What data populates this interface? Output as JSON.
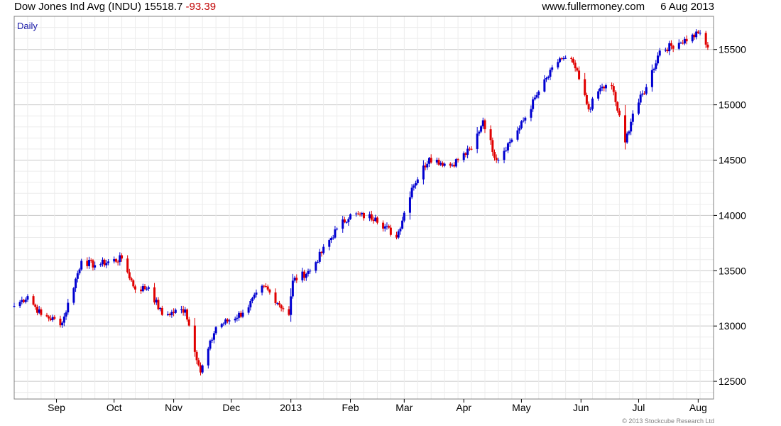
{
  "header": {
    "instrument": "Dow Jones Ind Avg (INDU)",
    "last": "15518.7",
    "change": "-93.39",
    "website": "www.fullermoney.com",
    "date": "6 Aug 2013"
  },
  "footer": {
    "copyright": "© 2013 Stockcube Research Ltd"
  },
  "colors": {
    "up": "#0000d0",
    "down": "#e00000",
    "grid_major": "#c8c8c8",
    "grid_minor": "#ececec",
    "frame": "#808080"
  },
  "chart_data": {
    "type": "line",
    "style": "daily high-low-close bars, blue up / red down",
    "period_label": "Daily",
    "y_axis_side": "right",
    "ylim": [
      12340,
      15800
    ],
    "y_ticks": [
      12500,
      13000,
      13500,
      14000,
      14500,
      15000,
      15500
    ],
    "x_tick_labels": [
      "Sep",
      "Oct",
      "Nov",
      "Dec",
      "2013",
      "Feb",
      "Mar",
      "Apr",
      "May",
      "Jun",
      "Jul",
      "Aug"
    ],
    "x_tick_dates": [
      "2012-09-01",
      "2012-10-01",
      "2012-11-01",
      "2012-12-01",
      "2013-01-01",
      "2013-02-01",
      "2013-03-01",
      "2013-04-01",
      "2013-05-01",
      "2013-06-01",
      "2013-07-01",
      "2013-08-01"
    ],
    "x_range": [
      "2012-08-10",
      "2013-08-09"
    ],
    "grid": true,
    "series": [
      {
        "anchor_dates": [
          "2012-08-10",
          "2012-08-17",
          "2012-08-24",
          "2012-09-04",
          "2012-09-14",
          "2012-09-21",
          "2012-10-05",
          "2012-10-12",
          "2012-10-19",
          "2012-10-26",
          "2012-11-07",
          "2012-11-15",
          "2012-11-23",
          "2012-12-07",
          "2012-12-18",
          "2012-12-31",
          "2013-01-02",
          "2013-01-11",
          "2013-01-25",
          "2013-02-01",
          "2013-02-14",
          "2013-02-25",
          "2013-03-05",
          "2013-03-14",
          "2013-03-25",
          "2013-04-05",
          "2013-04-11",
          "2013-04-18",
          "2013-04-30",
          "2013-05-10",
          "2013-05-21",
          "2013-05-28",
          "2013-06-05",
          "2013-06-11",
          "2013-06-17",
          "2013-06-24",
          "2013-06-28",
          "2013-07-05",
          "2013-07-12",
          "2013-07-22",
          "2013-08-02",
          "2013-08-06"
        ],
        "anchor_closes": [
          13180,
          13270,
          13100,
          13030,
          13590,
          13550,
          13610,
          13330,
          13350,
          13100,
          13150,
          12580,
          12990,
          13120,
          13360,
          13100,
          13410,
          13500,
          13880,
          14010,
          13980,
          13800,
          14250,
          14520,
          14450,
          14600,
          14860,
          14500,
          14790,
          15120,
          15420,
          15380,
          14960,
          15150,
          15170,
          14660,
          14920,
          15160,
          15490,
          15560,
          15650,
          15518.7
        ]
      }
    ]
  }
}
